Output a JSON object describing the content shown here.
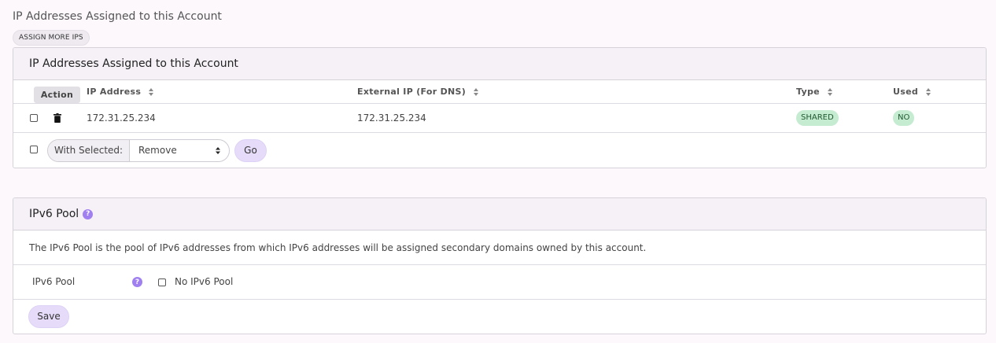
{
  "page": {
    "title": "IP Addresses Assigned to this Account",
    "assign_button": "ASSIGN MORE IPS"
  },
  "ip_panel": {
    "title": "IP Addresses Assigned to this Account",
    "columns": {
      "action": "Action",
      "ip": "IP Address",
      "external": "External IP (For DNS)",
      "type": "Type",
      "used": "Used"
    },
    "rows": [
      {
        "ip": "172.31.25.234",
        "external": "172.31.25.234",
        "type": "SHARED",
        "used": "NO"
      }
    ],
    "bulk": {
      "label": "With Selected:",
      "selected_option": "Remove",
      "go_label": "Go"
    }
  },
  "ipv6_panel": {
    "title": "IPv6 Pool",
    "description": "The IPv6 Pool is the pool of IPv6 addresses from which IPv6 addresses will be assigned secondary domains owned by this account.",
    "field_label": "IPv6 Pool",
    "checkbox_label": "No IPv6 Pool",
    "checkbox_checked": false,
    "save_label": "Save"
  },
  "icons": {
    "sort": "sort-icon",
    "delete": "trash-icon",
    "help": "help-icon",
    "select": "chevron-updown-icon"
  },
  "colors": {
    "accent": "#a07ff0",
    "button_bg": "#e6dcfa",
    "badge_bg": "#c5ebd1",
    "panel_header_bg": "#f5f1f7",
    "page_bg": "#fcf8fc"
  }
}
